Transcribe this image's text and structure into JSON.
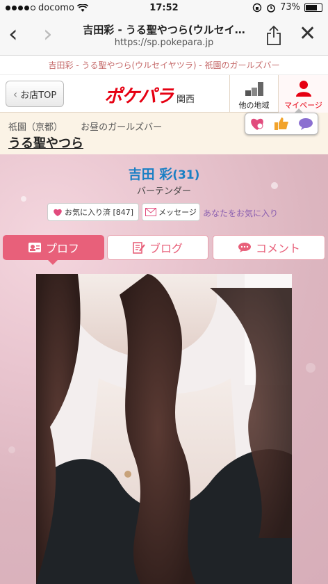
{
  "status_bar": {
    "carrier": "docomo",
    "time": "17:52",
    "battery": "73%",
    "battery_level": 0.73
  },
  "browser": {
    "page_title": "吉田彩 - うる聖やつら(ウルセイ…",
    "url": "https://sp.pokepara.jp"
  },
  "breadcrumb": "吉田彩 - うる聖やつら(ウルセイヤツラ) - 祇園のガールズバー",
  "header": {
    "shop_top_label": "お店TOP",
    "logo_text": "ポケパラ",
    "region": "関西",
    "other_region_label": "他の地域",
    "mypage_label": "マイページ",
    "accent_color": "#e60012"
  },
  "popover_icons": [
    "heart-icon",
    "thumbs-up-icon",
    "chat-bubble-icon"
  ],
  "shop": {
    "area": "祇園（京都）",
    "category": "お昼のガールズバー",
    "name": "うる聖やつら"
  },
  "profile": {
    "name": "吉田 彩",
    "age": "(31)",
    "role": "バーテンダー",
    "favorite_button": "お気に入り済 [847]",
    "message_button": "メッセージ",
    "favorited_you_link": "あなたをお気に入り"
  },
  "tabs": [
    {
      "label": "プロフ",
      "active": true
    },
    {
      "label": "ブログ",
      "active": false
    },
    {
      "label": "コメント",
      "active": false
    }
  ]
}
